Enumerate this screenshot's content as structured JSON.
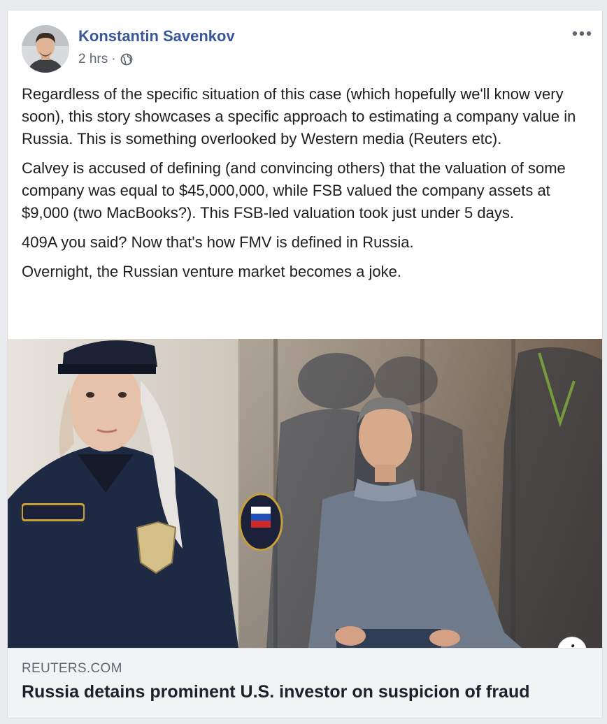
{
  "post": {
    "author_name": "Konstantin Savenkov",
    "timestamp": "2 hrs",
    "separator": "·",
    "privacy_icon": "globe-icon",
    "menu_icon": "more-options-icon",
    "paragraphs": [
      "Regardless of the specific situation of this case (which hopefully we'll know very soon), this story showcases a specific approach to estimating a company value in Russia. This is something overlooked by Western media (Reuters etc).",
      "Calvey is accused of defining (and convincing others) that the valuation of some company was equal to $45,000,000, while FSB valued the company assets at $9,000 (two MacBooks?). This FSB-led valuation took just under 5 days.",
      "409A you said? Now that's how FMV is defined in Russia.",
      "Overnight, the Russian venture market becomes a joke."
    ]
  },
  "link_preview": {
    "domain": "REUTERS.COM",
    "headline": "Russia detains prominent U.S. investor on suspicion of fraud",
    "info_icon": "info-icon",
    "info_glyph": "i"
  },
  "colors": {
    "author_link": "#385898",
    "meta_text": "#616770",
    "body_text": "#1c1e21",
    "page_bg": "#e9ebee",
    "footer_bg": "#f2f3f5"
  }
}
